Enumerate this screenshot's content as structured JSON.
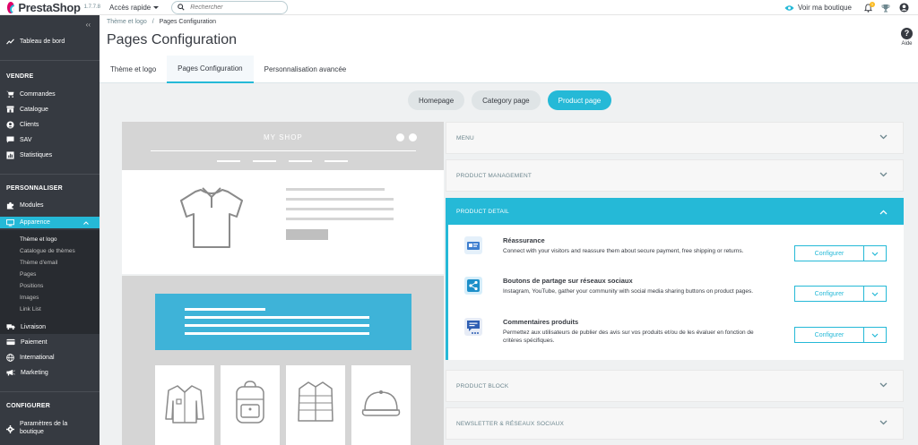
{
  "topbar": {
    "brand": "PrestaShop",
    "version": "1.7.7.8",
    "quick_access": "Accès rapide",
    "search_placeholder": "Rechercher",
    "view_shop": "Voir ma boutique",
    "notifications_count": "1"
  },
  "sidebar": {
    "dashboard": "Tableau de bord",
    "section_sell": "VENDRE",
    "sell_items": [
      "Commandes",
      "Catalogue",
      "Clients",
      "SAV",
      "Statistiques"
    ],
    "section_customize": "PERSONNALISER",
    "modules": "Modules",
    "appearance": "Apparence",
    "appearance_sub": [
      "Thème et logo",
      "Catalogue de thèmes",
      "Thème d'email",
      "Pages",
      "Positions",
      "Images",
      "Link List"
    ],
    "more_items": [
      "Livraison",
      "Paiement",
      "International",
      "Marketing"
    ],
    "section_configure": "CONFIGURER",
    "shop_params_line1": "Paramètres de la",
    "shop_params_line2": "boutique"
  },
  "header": {
    "breadcrumb_parent": "Thème et logo",
    "breadcrumb_sep": "/",
    "breadcrumb_current": "Pages Configuration",
    "title": "Pages Configuration",
    "help": "Aide"
  },
  "tabs": [
    "Thème et logo",
    "Pages Configuration",
    "Personnalisation avancée"
  ],
  "page_pills": [
    "Homepage",
    "Category page",
    "Product page"
  ],
  "preview": {
    "shop_name": "MY SHOP"
  },
  "accordion": {
    "menu": "MENU",
    "product_management": "PRODUCT MANAGEMENT",
    "product_detail": "PRODUCT DETAIL",
    "product_block": "PRODUCT BLOCK",
    "newsletter": "NEWSLETTER & RÉSEAUX SOCIAUX"
  },
  "modules": [
    {
      "title": "Réassurance",
      "desc": "Connect with your visitors and reassure them about secure payment, free shipping or returns.",
      "button": "Configurer"
    },
    {
      "title": "Boutons de partage sur réseaux sociaux",
      "desc": "Instagram, YouTube, gather your community with social media sharing buttons on product pages.",
      "button": "Configurer"
    },
    {
      "title": "Commentaires produits",
      "desc": "Permettez aux utilisateurs de publier des avis sur vos produits et/ou de les évaluer en fonction de critères spécifiques.",
      "button": "Configurer"
    }
  ],
  "colors": {
    "accent": "#25b9d7",
    "sidebar": "#363a41",
    "brand": "#df0067"
  }
}
